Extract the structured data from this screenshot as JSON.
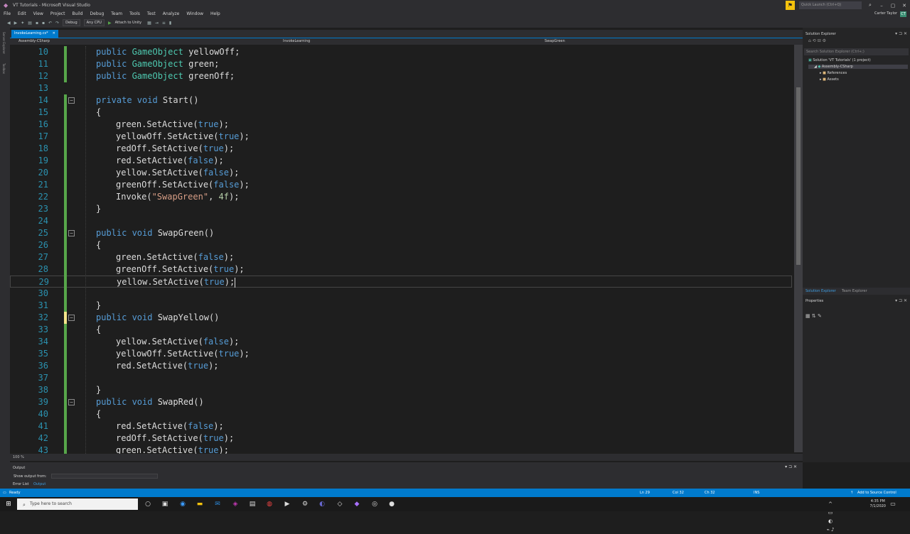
{
  "window": {
    "title": "VT Tutorials - Microsoft Visual Studio",
    "quick_launch_placeholder": "Quick Launch (Ctrl+Q)",
    "notification_icon": "flag-icon",
    "user_name": "Carter Taylor",
    "user_initials": "CT"
  },
  "menu": [
    "File",
    "Edit",
    "View",
    "Project",
    "Build",
    "Debug",
    "Team",
    "Tools",
    "Test",
    "Analyze",
    "Window",
    "Help"
  ],
  "toolbar": {
    "configuration": "Debug",
    "platform": "Any CPU",
    "attach_label": "Attach to Unity"
  },
  "left_strip": [
    "Server Explorer",
    "Toolbox"
  ],
  "editor": {
    "tab_label": "InvokeLearning.cs*",
    "nav_project": "Assembly-CSharp",
    "nav_class": "InvokeLearning",
    "nav_member": "SwapGreen",
    "zoom": "100 %",
    "lines": [
      {
        "n": "10",
        "tokens": [
          [
            "k",
            "public "
          ],
          [
            "t",
            "GameObject "
          ],
          [
            "p",
            "yellowOff;"
          ]
        ]
      },
      {
        "n": "11",
        "tokens": [
          [
            "k",
            "public "
          ],
          [
            "t",
            "GameObject "
          ],
          [
            "p",
            "green;"
          ]
        ]
      },
      {
        "n": "12",
        "tokens": [
          [
            "k",
            "public "
          ],
          [
            "t",
            "GameObject "
          ],
          [
            "p",
            "greenOff;"
          ]
        ]
      },
      {
        "n": "13",
        "tokens": []
      },
      {
        "n": "14",
        "collapse": true,
        "tokens": [
          [
            "k",
            "private "
          ],
          [
            "k",
            "void "
          ],
          [
            "p",
            "Start()"
          ]
        ]
      },
      {
        "n": "15",
        "tokens": [
          [
            "p",
            "{"
          ]
        ]
      },
      {
        "n": "16",
        "indent": 1,
        "tokens": [
          [
            "p",
            "green.SetActive("
          ],
          [
            "k",
            "true"
          ],
          [
            "p",
            ");"
          ]
        ]
      },
      {
        "n": "17",
        "indent": 1,
        "tokens": [
          [
            "p",
            "yellowOff.SetActive("
          ],
          [
            "k",
            "true"
          ],
          [
            "p",
            ");"
          ]
        ]
      },
      {
        "n": "18",
        "indent": 1,
        "tokens": [
          [
            "p",
            "redOff.SetActive("
          ],
          [
            "k",
            "true"
          ],
          [
            "p",
            ");"
          ]
        ]
      },
      {
        "n": "19",
        "indent": 1,
        "tokens": [
          [
            "p",
            "red.SetActive("
          ],
          [
            "k",
            "false"
          ],
          [
            "p",
            ");"
          ]
        ]
      },
      {
        "n": "20",
        "indent": 1,
        "tokens": [
          [
            "p",
            "yellow.SetActive("
          ],
          [
            "k",
            "false"
          ],
          [
            "p",
            ");"
          ]
        ]
      },
      {
        "n": "21",
        "indent": 1,
        "tokens": [
          [
            "p",
            "greenOff.SetActive("
          ],
          [
            "k",
            "false"
          ],
          [
            "p",
            ");"
          ]
        ]
      },
      {
        "n": "22",
        "indent": 1,
        "tokens": [
          [
            "p",
            "Invoke("
          ],
          [
            "s",
            "\"SwapGreen\""
          ],
          [
            "p",
            ", "
          ],
          [
            "n",
            "4f"
          ],
          [
            "p",
            ");"
          ]
        ]
      },
      {
        "n": "23",
        "tokens": [
          [
            "p",
            "}"
          ]
        ]
      },
      {
        "n": "24",
        "tokens": []
      },
      {
        "n": "25",
        "collapse": true,
        "tokens": [
          [
            "k",
            "public "
          ],
          [
            "k",
            "void "
          ],
          [
            "p",
            "SwapGreen()"
          ]
        ]
      },
      {
        "n": "26",
        "tokens": [
          [
            "p",
            "{"
          ]
        ]
      },
      {
        "n": "27",
        "indent": 1,
        "tokens": [
          [
            "p",
            "green.SetActive("
          ],
          [
            "k",
            "false"
          ],
          [
            "p",
            ");"
          ]
        ]
      },
      {
        "n": "28",
        "indent": 1,
        "tokens": [
          [
            "p",
            "greenOff.SetActive("
          ],
          [
            "k",
            "true"
          ],
          [
            "p",
            ");"
          ]
        ]
      },
      {
        "n": "29",
        "indent": 1,
        "current": true,
        "tokens": [
          [
            "p",
            "yellow.SetActive("
          ],
          [
            "k",
            "true"
          ],
          [
            "p",
            ");"
          ]
        ]
      },
      {
        "n": "30",
        "tokens": []
      },
      {
        "n": "31",
        "tokens": [
          [
            "p",
            "}"
          ]
        ]
      },
      {
        "n": "32",
        "collapse": true,
        "tokens": [
          [
            "k",
            "public "
          ],
          [
            "k",
            "void "
          ],
          [
            "p",
            "SwapYellow()"
          ]
        ]
      },
      {
        "n": "33",
        "tokens": [
          [
            "p",
            "{"
          ]
        ]
      },
      {
        "n": "34",
        "indent": 1,
        "tokens": [
          [
            "p",
            "yellow.SetActive("
          ],
          [
            "k",
            "false"
          ],
          [
            "p",
            ");"
          ]
        ]
      },
      {
        "n": "35",
        "indent": 1,
        "tokens": [
          [
            "p",
            "yellowOff.SetActive("
          ],
          [
            "k",
            "true"
          ],
          [
            "p",
            ");"
          ]
        ]
      },
      {
        "n": "36",
        "indent": 1,
        "tokens": [
          [
            "p",
            "red.SetActive("
          ],
          [
            "k",
            "true"
          ],
          [
            "p",
            ");"
          ]
        ]
      },
      {
        "n": "37",
        "tokens": []
      },
      {
        "n": "38",
        "tokens": [
          [
            "p",
            "}"
          ]
        ]
      },
      {
        "n": "39",
        "collapse": true,
        "tokens": [
          [
            "k",
            "public "
          ],
          [
            "k",
            "void "
          ],
          [
            "p",
            "SwapRed()"
          ]
        ]
      },
      {
        "n": "40",
        "tokens": [
          [
            "p",
            "{"
          ]
        ]
      },
      {
        "n": "41",
        "indent": 1,
        "tokens": [
          [
            "p",
            "red.SetActive("
          ],
          [
            "k",
            "false"
          ],
          [
            "p",
            ");"
          ]
        ]
      },
      {
        "n": "42",
        "indent": 1,
        "tokens": [
          [
            "p",
            "redOff.SetActive("
          ],
          [
            "k",
            "true"
          ],
          [
            "p",
            ");"
          ]
        ]
      },
      {
        "n": "43",
        "indent": 1,
        "tokens": [
          [
            "p",
            "green.SetActive("
          ],
          [
            "k",
            "true"
          ],
          [
            "p",
            ");"
          ]
        ]
      }
    ]
  },
  "solution_explorer": {
    "title": "Solution Explorer",
    "search_placeholder": "Search Solution Explorer (Ctrl+;)",
    "tree": [
      {
        "label": "Solution 'VT Tutorials' (1 project)",
        "level": 0
      },
      {
        "label": "Assembly-CSharp",
        "level": 1,
        "selected": true
      },
      {
        "label": "References",
        "level": 2
      },
      {
        "label": "Assets",
        "level": 2
      }
    ],
    "tabs": [
      "Solution Explorer",
      "Team Explorer"
    ]
  },
  "properties": {
    "title": "Properties"
  },
  "output": {
    "title": "Output",
    "show_output_label": "Show output from:",
    "tabs": [
      "Error List",
      "Output"
    ]
  },
  "status": {
    "state": "Ready",
    "ln": "Ln 29",
    "col": "Col 32",
    "ch": "Ch 32",
    "mode": "INS",
    "source_control": "Add to Source Control"
  },
  "taskbar": {
    "search_placeholder": "Type here to search",
    "time": "4:35 PM",
    "date": "7/1/2020"
  },
  "colors": {
    "accent": "#007acc",
    "keyword": "#569cd6",
    "type": "#4ec9b0",
    "string": "#d69d85",
    "number": "#b5cea8",
    "linenum": "#2b91af"
  }
}
